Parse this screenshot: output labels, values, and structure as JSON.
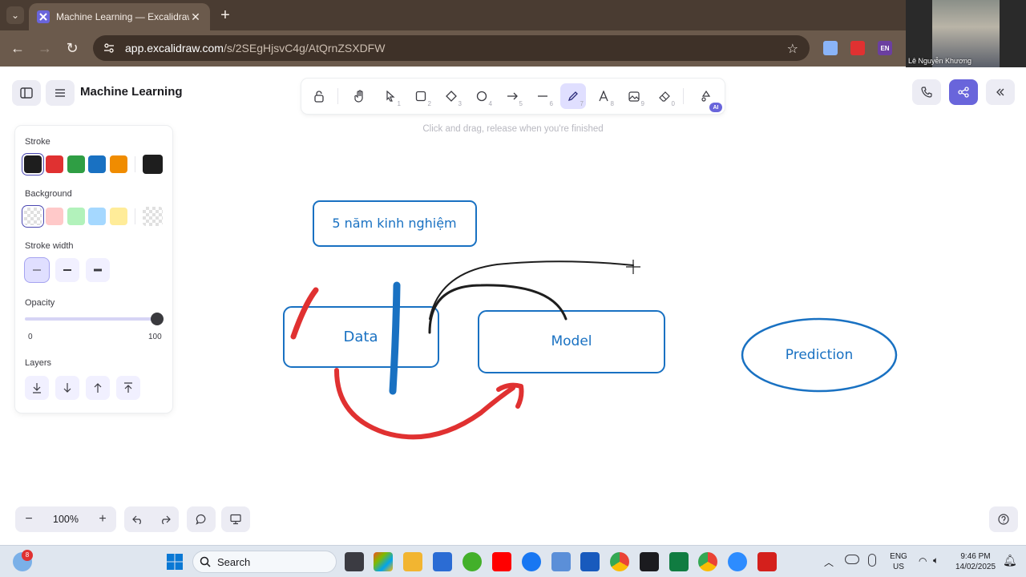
{
  "browser": {
    "tab_title": "Machine Learning — Excalidraw Plus",
    "url_host": "app.excalidraw.com",
    "url_path": "/s/2SEgHjsvC4g/AtQrnZSXDFW",
    "ext_lang": "EN"
  },
  "webcam": {
    "name": "Lê Nguyễn Khương"
  },
  "app": {
    "title": "Machine Learning",
    "hint": "Click and drag, release when you're finished",
    "colors": {
      "accent": "#6965db",
      "stroke_blue": "#1971c2",
      "stroke_red": "#e03131",
      "stroke_black": "#1e1e1e"
    }
  },
  "toolbar": {
    "tools": [
      {
        "name": "lock",
        "num": ""
      },
      {
        "name": "hand",
        "num": ""
      },
      {
        "name": "selection",
        "num": "1"
      },
      {
        "name": "rectangle",
        "num": "2"
      },
      {
        "name": "diamond",
        "num": "3"
      },
      {
        "name": "ellipse",
        "num": "4"
      },
      {
        "name": "arrow",
        "num": "5"
      },
      {
        "name": "line",
        "num": "6"
      },
      {
        "name": "draw",
        "num": "7"
      },
      {
        "name": "text",
        "num": "8"
      },
      {
        "name": "image",
        "num": "9"
      },
      {
        "name": "eraser",
        "num": "0"
      }
    ],
    "ai_badge": "AI",
    "active_tool": "draw"
  },
  "panel": {
    "stroke_label": "Stroke",
    "stroke_colors": [
      "#1e1e1e",
      "#e03131",
      "#2f9e44",
      "#1971c2",
      "#f08c00"
    ],
    "stroke_current": "#1e1e1e",
    "background_label": "Background",
    "background_colors": [
      "transparent",
      "#ffc9c9",
      "#b2f2bb",
      "#a5d8ff",
      "#ffec99"
    ],
    "stroke_width_label": "Stroke width",
    "opacity_label": "Opacity",
    "opacity_min": "0",
    "opacity_max": "100",
    "opacity_value": 100,
    "layers_label": "Layers"
  },
  "footer": {
    "zoom": "100%"
  },
  "canvas": {
    "box_experience": "5 năm kinh nghiệm",
    "box_data": "Data",
    "box_model": "Model",
    "ellipse_prediction": "Prediction"
  },
  "taskbar": {
    "search_placeholder": "Search",
    "weather_badge": "8",
    "lang_top": "ENG",
    "lang_bottom": "US",
    "time": "9:46 PM",
    "date": "14/02/2025"
  }
}
